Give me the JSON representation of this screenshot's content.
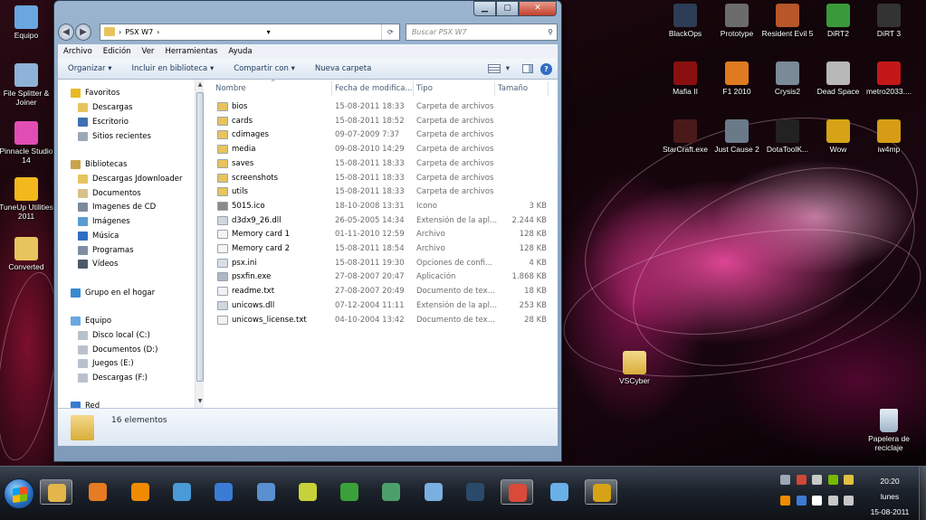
{
  "colors": {
    "folder": "#e7c45e",
    "selection_text": "#1e395b",
    "muted_text": "#6d6d6d",
    "close_button": "#c2402c"
  },
  "desktop": {
    "left_icons": [
      {
        "label": "Equipo",
        "icon": "computer-icon",
        "color": "#6aa7e0"
      },
      {
        "label": "File Splitter & Joiner",
        "icon": "file-splitter-icon",
        "color": "#8fb2d8"
      },
      {
        "label": "Pinnacle Studio 14",
        "icon": "pinnacle-icon",
        "color": "#e04db5"
      },
      {
        "label": "TuneUp Utilities 2011",
        "icon": "tuneup-icon",
        "color": "#f2b81c"
      },
      {
        "label": "Converted",
        "icon": "folder-icon",
        "color": "#e7c45e"
      }
    ],
    "right_icons": [
      {
        "label": "BlackOps",
        "icon": "blackops-icon",
        "color": "#2c3d55"
      },
      {
        "label": "Prototype",
        "icon": "prototype-icon",
        "color": "#6c6c6c"
      },
      {
        "label": "Resident Evil 5",
        "icon": "resident-evil-icon",
        "color": "#b7562b"
      },
      {
        "label": "DiRT2",
        "icon": "dirt2-icon",
        "color": "#3a9a3a"
      },
      {
        "label": "DiRT 3",
        "icon": "dirt3-icon",
        "color": "#333333"
      },
      {
        "label": "Mafia II",
        "icon": "mafia-icon",
        "color": "#8a1010"
      },
      {
        "label": "F1 2010",
        "icon": "f1-icon",
        "color": "#e07a20"
      },
      {
        "label": "Crysis2",
        "icon": "crysis-icon",
        "color": "#7a8a96"
      },
      {
        "label": "Dead Space",
        "icon": "deadspace-icon",
        "color": "#b8b8b8"
      },
      {
        "label": "metro2033....",
        "icon": "metro-icon",
        "color": "#c41818"
      },
      {
        "label": "StarCraft.exe",
        "icon": "starcraft-icon",
        "color": "#4a1a1a"
      },
      {
        "label": "Just Cause 2",
        "icon": "justcause-icon",
        "color": "#6a7a88"
      },
      {
        "label": "DotaToolK...",
        "icon": "dota-icon",
        "color": "#222222"
      },
      {
        "label": "Wow",
        "icon": "wow-icon",
        "color": "#d6a316"
      },
      {
        "label": "iw4mp",
        "icon": "iw4mp-icon",
        "color": "#d69c16"
      }
    ],
    "vscyber": {
      "label": "VSCyber",
      "icon": "folder-icon"
    },
    "recycle": {
      "label": "Papelera de reciclaje",
      "icon": "recycle-bin-icon"
    }
  },
  "window": {
    "breadcrumb": "PSX W7",
    "search_placeholder": "Buscar PSX W7",
    "menu": [
      "Archivo",
      "Edición",
      "Ver",
      "Herramientas",
      "Ayuda"
    ],
    "commands": [
      "Organizar ▾",
      "Incluir en biblioteca ▾",
      "Compartir con ▾",
      "Nueva carpeta"
    ],
    "status": "16 elementos"
  },
  "nav": {
    "favorites": {
      "header": "Favoritos",
      "items": [
        "Descargas",
        "Escritorio",
        "Sitios recientes"
      ]
    },
    "libraries": {
      "header": "Bibliotecas",
      "items": [
        "Descargas Jdownloader",
        "Documentos",
        "Imagenes de CD",
        "Imágenes",
        "Música",
        "Programas",
        "Vídeos"
      ]
    },
    "homegroup": "Grupo en el hogar",
    "computer": {
      "header": "Equipo",
      "items": [
        "Disco local (C:)",
        "Documentos (D:)",
        "Juegos (E:)",
        "Descargas (F:)"
      ]
    },
    "network": "Red"
  },
  "files": {
    "columns": [
      "Nombre",
      "Fecha de modifica...",
      "Tipo",
      "Tamaño"
    ],
    "rows": [
      {
        "name": "bios",
        "date": "15-08-2011 18:33",
        "type": "Carpeta de archivos",
        "size": "",
        "icon": "folder-icon"
      },
      {
        "name": "cards",
        "date": "15-08-2011 18:52",
        "type": "Carpeta de archivos",
        "size": "",
        "icon": "folder-icon"
      },
      {
        "name": "cdimages",
        "date": "09-07-2009 7:37",
        "type": "Carpeta de archivos",
        "size": "",
        "icon": "folder-icon"
      },
      {
        "name": "media",
        "date": "09-08-2010 14:29",
        "type": "Carpeta de archivos",
        "size": "",
        "icon": "folder-icon"
      },
      {
        "name": "saves",
        "date": "15-08-2011 18:33",
        "type": "Carpeta de archivos",
        "size": "",
        "icon": "folder-icon"
      },
      {
        "name": "screenshots",
        "date": "15-08-2011 18:33",
        "type": "Carpeta de archivos",
        "size": "",
        "icon": "folder-icon"
      },
      {
        "name": "utils",
        "date": "15-08-2011 18:33",
        "type": "Carpeta de archivos",
        "size": "",
        "icon": "folder-icon"
      },
      {
        "name": "5015.ico",
        "date": "18-10-2008 13:31",
        "type": "Icono",
        "size": "3 KB",
        "icon": "ico-file-icon"
      },
      {
        "name": "d3dx9_26.dll",
        "date": "26-05-2005 14:34",
        "type": "Extensión de la apl...",
        "size": "2.244 KB",
        "icon": "dll-file-icon"
      },
      {
        "name": "Memory card 1",
        "date": "01-11-2010 12:59",
        "type": "Archivo",
        "size": "128 KB",
        "icon": "blank-file-icon"
      },
      {
        "name": "Memory card 2",
        "date": "15-08-2011 18:54",
        "type": "Archivo",
        "size": "128 KB",
        "icon": "blank-file-icon"
      },
      {
        "name": "psx.ini",
        "date": "15-08-2011 19:30",
        "type": "Opciones de confi...",
        "size": "4 KB",
        "icon": "ini-file-icon"
      },
      {
        "name": "psxfin.exe",
        "date": "27-08-2007 20:47",
        "type": "Aplicación",
        "size": "1.868 KB",
        "icon": "exe-file-icon"
      },
      {
        "name": "readme.txt",
        "date": "27-08-2007 20:49",
        "type": "Documento de tex...",
        "size": "18 KB",
        "icon": "txt-file-icon"
      },
      {
        "name": "unicows.dll",
        "date": "07-12-2004 11:11",
        "type": "Extensión de la apl...",
        "size": "253 KB",
        "icon": "dll-file-icon"
      },
      {
        "name": "unicows_license.txt",
        "date": "04-10-2004 13:42",
        "type": "Documento de tex...",
        "size": "28 KB",
        "icon": "txt-file-icon"
      }
    ]
  },
  "taskbar": {
    "apps": [
      {
        "icon": "explorer-icon",
        "color": "#e2b64a",
        "active": true
      },
      {
        "icon": "media-player-icon",
        "color": "#e57b22",
        "active": false
      },
      {
        "icon": "vlc-icon",
        "color": "#f08a00",
        "active": false
      },
      {
        "icon": "messenger-icon",
        "color": "#4a9ad8",
        "active": false
      },
      {
        "icon": "ccleaner-icon",
        "color": "#3a7bd5",
        "active": false
      },
      {
        "icon": "network-icon",
        "color": "#5a8fd0",
        "active": false
      },
      {
        "icon": "sticky-icon",
        "color": "#c7d23a",
        "active": false
      },
      {
        "icon": "utorrent-icon",
        "color": "#3aa13a",
        "active": false
      },
      {
        "icon": "task-manager-icon",
        "color": "#4c9f6a",
        "active": false
      },
      {
        "icon": "paint-icon",
        "color": "#7ab0e0",
        "active": false
      },
      {
        "icon": "steam-icon",
        "color": "#2a4a6a",
        "active": false
      },
      {
        "icon": "chrome-icon",
        "color": "#d94a38",
        "active": true
      },
      {
        "icon": "messenger-people-icon",
        "color": "#6ab0e8",
        "active": false
      },
      {
        "icon": "wow-icon",
        "color": "#d6a316",
        "active": true
      }
    ],
    "tray_icons": [
      {
        "icon": "settings-tray-icon",
        "color": "#9aa8b8"
      },
      {
        "icon": "gmail-tray-icon",
        "color": "#d14836"
      },
      {
        "icon": "steam-tray-icon",
        "color": "#c8c8c8"
      },
      {
        "icon": "nvidia-tray-icon",
        "color": "#76b900"
      },
      {
        "icon": "people-tray-icon",
        "color": "#e0c040"
      },
      {
        "icon": "avast-tray-icon",
        "color": "#f08a00"
      },
      {
        "icon": "bluetooth-tray-icon",
        "color": "#3a7bd5"
      },
      {
        "icon": "flag-tray-icon",
        "color": "#ffffff"
      },
      {
        "icon": "network-tray-icon",
        "color": "#c8c8c8"
      },
      {
        "icon": "volume-tray-icon",
        "color": "#c8c8c8"
      }
    ],
    "clock": {
      "time": "20:20",
      "day": "lunes",
      "date": "15-08-2011"
    }
  }
}
